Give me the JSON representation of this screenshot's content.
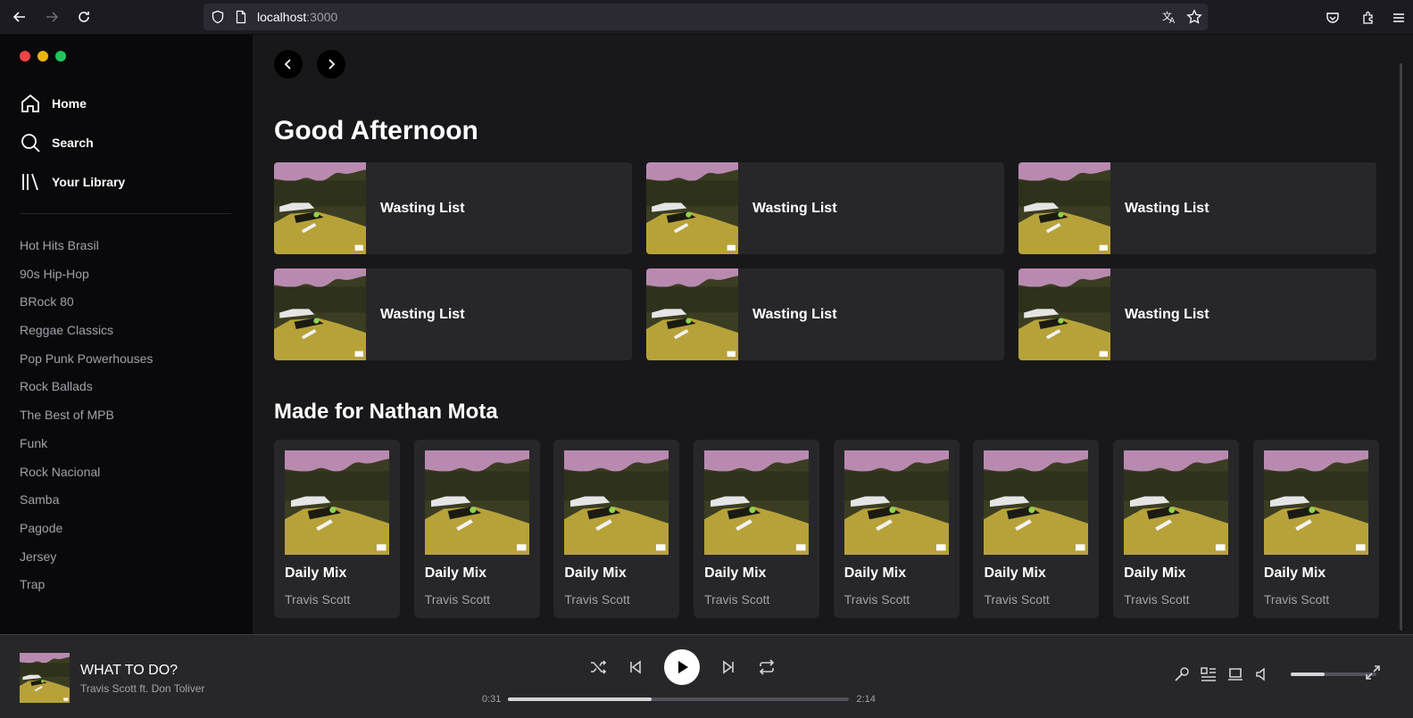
{
  "browser": {
    "url_host": "localhost",
    "url_port": ":3000"
  },
  "sidebar": {
    "nav": [
      {
        "label": "Home",
        "icon": "home-icon"
      },
      {
        "label": "Search",
        "icon": "search-icon"
      },
      {
        "label": "Your Library",
        "icon": "library-icon"
      }
    ],
    "playlists": [
      "Hot Hits Brasil",
      "90s Hip-Hop",
      "BRock 80",
      "Reggae Classics",
      "Pop Punk Powerhouses",
      "Rock Ballads",
      "The Best of MPB",
      "Funk",
      "Rock Nacional",
      "Samba",
      "Pagode",
      "Jersey",
      "Trap"
    ]
  },
  "main": {
    "greeting": "Good Afternoon",
    "recent": [
      "Wasting List",
      "Wasting List",
      "Wasting List",
      "Wasting List",
      "Wasting List",
      "Wasting List"
    ],
    "made_for_title": "Made for Nathan Mota",
    "mixes": [
      {
        "title": "Daily Mix",
        "artist": "Travis Scott"
      },
      {
        "title": "Daily Mix",
        "artist": "Travis Scott"
      },
      {
        "title": "Daily Mix",
        "artist": "Travis Scott"
      },
      {
        "title": "Daily Mix",
        "artist": "Travis Scott"
      },
      {
        "title": "Daily Mix",
        "artist": "Travis Scott"
      },
      {
        "title": "Daily Mix",
        "artist": "Travis Scott"
      },
      {
        "title": "Daily Mix",
        "artist": "Travis Scott"
      },
      {
        "title": "Daily Mix",
        "artist": "Travis Scott"
      }
    ]
  },
  "player": {
    "song": "WHAT TO DO?",
    "artist": "Travis Scott ft. Don Toliver",
    "elapsed": "0:31",
    "duration": "2:14",
    "progress_fraction": 0.42,
    "volume_fraction": 0.4
  },
  "colors": {
    "sidebar_bg": "#09090b",
    "main_bg": "#18181b",
    "card_bg": "#27272a",
    "muted_text": "#a1a1aa"
  }
}
